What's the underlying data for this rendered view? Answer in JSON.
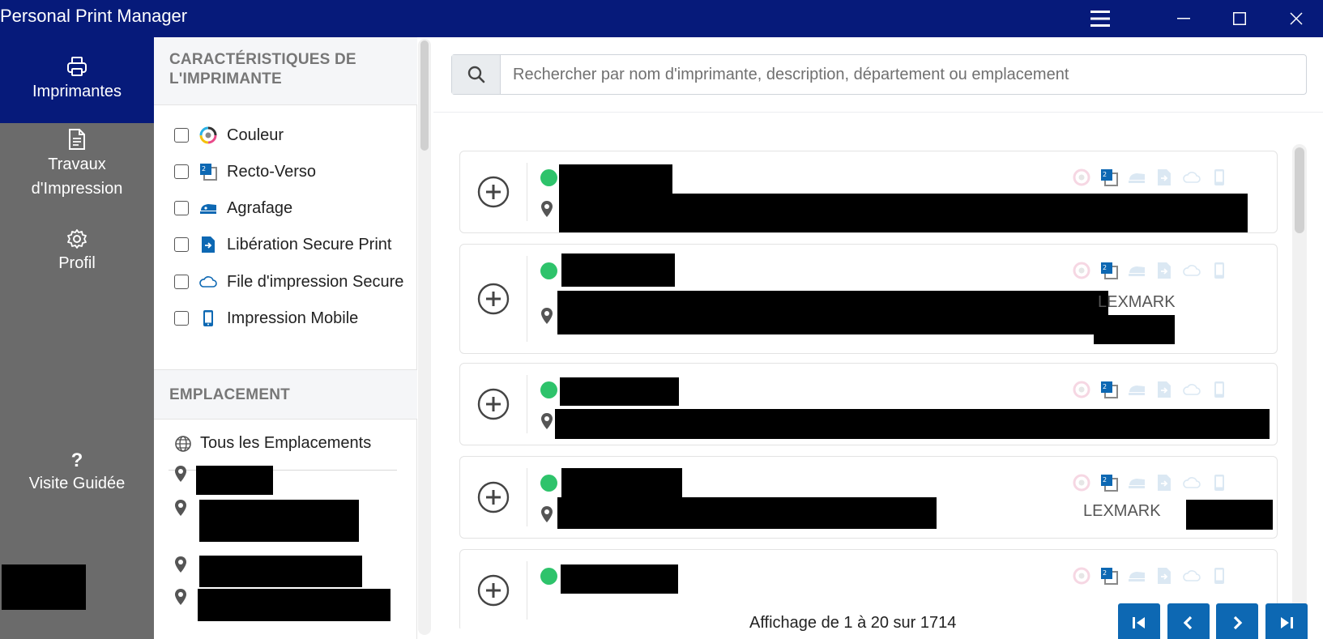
{
  "window": {
    "title": "Personal Print Manager"
  },
  "nav": {
    "printers": "Imprimantes",
    "jobs_line1": "Travaux",
    "jobs_line2": "d'Impression",
    "profile": "Profil",
    "tour_mark": "?",
    "tour": "Visite Guidée"
  },
  "filters": {
    "features_header_line1": "CARACTÉRISTIQUES DE",
    "features_header_line2": "L'IMPRIMANTE",
    "features": [
      {
        "label": "Couleur",
        "icon": "color-wheel-icon",
        "checked": false
      },
      {
        "label": "Recto-Verso",
        "icon": "duplex-icon",
        "checked": false
      },
      {
        "label": "Agrafage",
        "icon": "stapler-icon",
        "checked": false
      },
      {
        "label": "Libération Secure Print",
        "icon": "secure-release-icon",
        "checked": false
      },
      {
        "label": "File d'impression Secure",
        "icon": "cloud-icon",
        "checked": false
      },
      {
        "label": "Impression Mobile",
        "icon": "mobile-icon",
        "checked": false
      }
    ],
    "location_header": "EMPLACEMENT",
    "all_locations": "Tous les Emplacements"
  },
  "search": {
    "placeholder": "Rechercher par nom d'imprimante, description, département ou emplacement"
  },
  "printers": [
    {
      "status": "online",
      "brand": ""
    },
    {
      "status": "online",
      "brand": "LEXMARK"
    },
    {
      "status": "online",
      "brand": ""
    },
    {
      "status": "online",
      "brand": "LEXMARK"
    },
    {
      "status": "online",
      "brand": ""
    }
  ],
  "pagination": {
    "text": "Affichage de 1 à 20 sur 1714"
  },
  "colors": {
    "titlebar": "#061a7a",
    "nav_bg": "#6b6b6b",
    "accent": "#0d68b3",
    "status_online": "#2ec36b"
  }
}
